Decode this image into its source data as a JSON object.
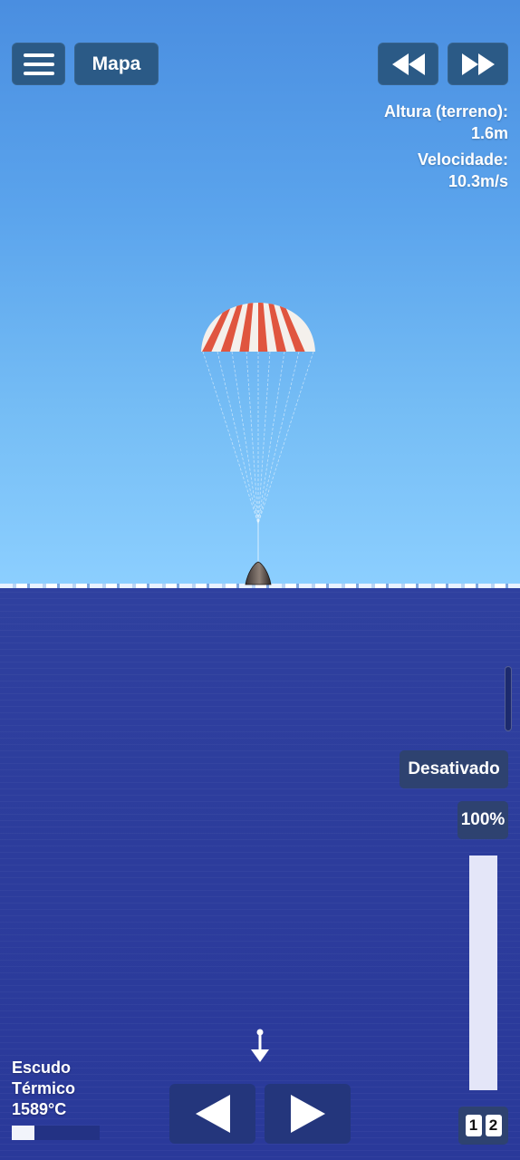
{
  "top_bar": {
    "menu_icon": "hamburger-icon",
    "map_label": "Mapa",
    "rewind_icon": "rewind-icon",
    "fast_forward_icon": "fast-forward-icon"
  },
  "telemetry": {
    "altitude_label": "Altura (terreno):",
    "altitude_value": "1.6m",
    "velocity_label": "Velocidade:",
    "velocity_value": "10.3m/s"
  },
  "scene": {
    "parachute_colors": [
      "#e0553f",
      "#f4f0ec"
    ],
    "capsule_icon": "capsule-icon",
    "sky_color": "#5aa3ec",
    "sea_color": "#2c3c9c"
  },
  "controls": {
    "mode_label": "Desativado",
    "throttle_label": "100%",
    "throttle_level": 1.0,
    "heat_shield_line1": "Escudo",
    "heat_shield_line2": "Térmico",
    "heat_shield_temp": "1589°C",
    "heat_shield_level": 0.26,
    "down_arrow_icon": "arrow-down-icon",
    "left_icon": "triangle-left-icon",
    "right_icon": "triangle-right-icon",
    "stage_digits": [
      "1",
      "2"
    ]
  }
}
